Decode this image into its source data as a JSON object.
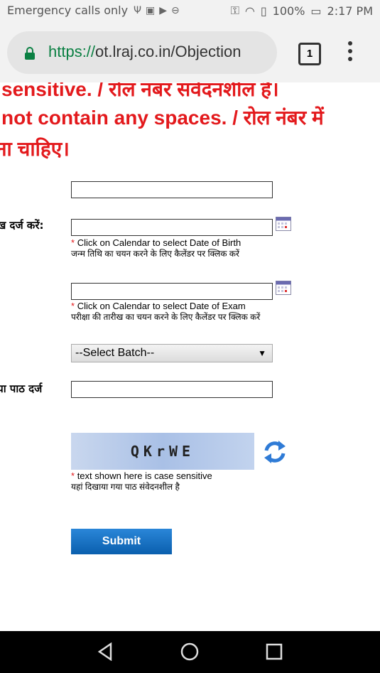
{
  "status_bar": {
    "carrier": "Emergency calls only",
    "battery": "100%",
    "time": "2:17 PM"
  },
  "browser": {
    "url_scheme": "https://",
    "url_rest": "ot.lraj.co.in/Objection",
    "tab_count": "1"
  },
  "page": {
    "notice_lines": [
      "sensitive. / रोल नंबर संवेदनशील है।",
      "not contain any spaces. / रोल नंबर में",
      "ना चाहिए।"
    ],
    "dob_label": "ख दर्ज करें:",
    "dob_hint_en": "Click on Calendar to select Date of Birth",
    "dob_hint_hi": "जन्म तिथि का चयन करने के लिए कैलेंडर पर क्लिक करें",
    "exam_hint_en": "Click on Calendar to select Date of Exam",
    "exam_hint_hi": "परीक्षा की तारीख का चयन करने के लिए कैलेंडर पर क्लिक करें",
    "batch_selected": "--Select Batch--",
    "captcha_label": "या पाठ दर्ज",
    "captcha_text": "QKrWE",
    "captcha_hint_en": "text shown here is case sensitive",
    "captcha_hint_hi": "यहां दिखाया गया पाठ संवेदनशील है",
    "submit_label": "Submit",
    "required_mark": "*"
  }
}
